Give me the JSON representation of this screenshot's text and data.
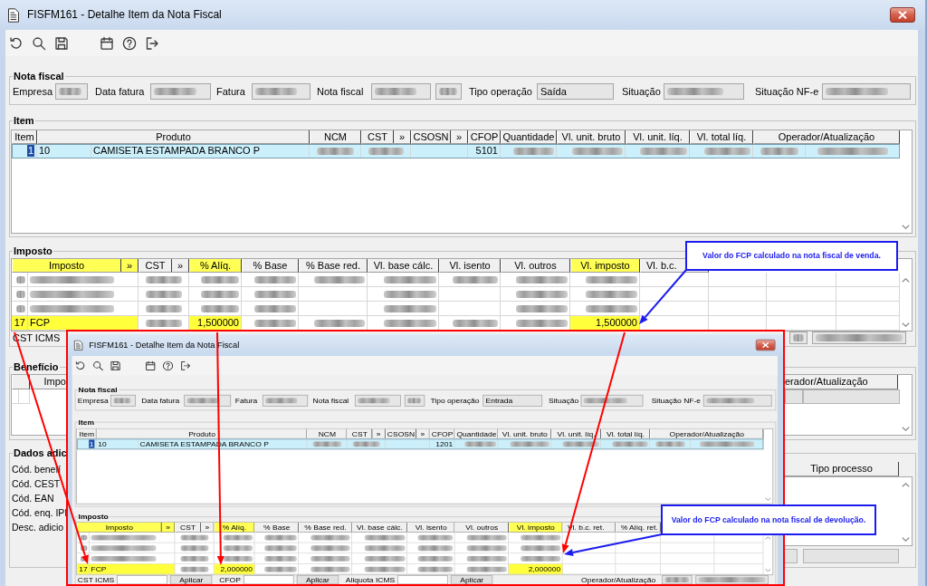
{
  "window": {
    "title": "FISFM161 - Detalhe Item da Nota Fiscal",
    "nota_fiscal": {
      "title": "Nota fiscal",
      "fields": [
        {
          "label": "Empresa",
          "kind": "blurred"
        },
        {
          "label": "Data fatura",
          "kind": "blurred"
        },
        {
          "label": "Fatura",
          "kind": "blurred"
        },
        {
          "label": "Nota fiscal",
          "kind": "blurred"
        },
        {
          "kind": "blurred"
        },
        {
          "label": "Tipo operação",
          "kind": "text",
          "value": "Saída"
        },
        {
          "label": "Situação",
          "kind": "blurred"
        },
        {
          "label": "Situação NF-e",
          "kind": "blurred"
        }
      ]
    },
    "item": {
      "title": "Item",
      "columns": [
        {
          "kind": "header",
          "label": "Item"
        },
        {
          "kind": "joined"
        },
        {
          "kind": "header",
          "label": "Produto"
        },
        {
          "kind": "header",
          "label": "NCM"
        },
        {
          "kind": "header",
          "label": "CST",
          "button": "»"
        },
        {
          "kind": "header",
          "label": "CSOSN",
          "button": "»"
        },
        {
          "kind": "header",
          "label": "CFOP"
        },
        {
          "kind": "header",
          "label": "Quantidade"
        },
        {
          "kind": "header",
          "label": "Vl. unit. bruto"
        },
        {
          "kind": "header",
          "label": "Vl. unit. líq."
        },
        {
          "kind": "header",
          "label": "Vl. total líq."
        },
        {
          "kind": "joined"
        },
        {
          "kind": "header",
          "label": "Operador/Atualização"
        }
      ],
      "rows": [
        {
          "selected": true,
          "cells": [
            {
              "kind": "text",
              "text": "1"
            },
            {
              "kind": "text",
              "text": "10"
            },
            {
              "kind": "text",
              "text": "CAMISETA ESTAMPADA BRANCO P"
            },
            {
              "kind": "blurred"
            },
            {
              "kind": "blurred"
            },
            {
              "kind": "empty"
            },
            {
              "kind": "text",
              "text": "5101"
            },
            {
              "kind": "blurred"
            },
            {
              "kind": "blurred"
            },
            {
              "kind": "blurred"
            },
            {
              "kind": "blurred"
            },
            {
              "kind": "blurred"
            },
            {
              "kind": "blurred"
            }
          ]
        }
      ]
    },
    "imposto": {
      "title": "Imposto",
      "columns": [
        {
          "kind": "joined",
          "highlighted": true
        },
        {
          "kind": "header",
          "label": "Imposto",
          "button": "»",
          "highlighted": true
        },
        {
          "kind": "header",
          "label": "CST",
          "button": "»",
          "highlighted": false
        },
        {
          "kind": "header",
          "label": "% Alíq.",
          "highlighted": true
        },
        {
          "kind": "header",
          "label": "% Base",
          "highlighted": false
        },
        {
          "kind": "header",
          "label": "% Base red.",
          "highlighted": false
        },
        {
          "kind": "header",
          "label": "Vl. base cálc.",
          "highlighted": false
        },
        {
          "kind": "header",
          "label": "Vl. isento",
          "highlighted": false
        },
        {
          "kind": "header",
          "label": "Vl. outros",
          "highlighted": false
        },
        {
          "kind": "header",
          "label": "Vl. imposto",
          "highlighted": true
        },
        {
          "kind": "header",
          "label": "Vl. b.c.",
          "highlighted": false
        }
      ],
      "rows": [
        {
          "highlighted": false,
          "cells": [
            {
              "kind": "blurred"
            },
            {
              "kind": "blurred"
            },
            {
              "kind": "blurred"
            },
            {
              "kind": "blurred"
            },
            {
              "kind": "blurred"
            },
            {
              "kind": "blurred"
            },
            {
              "kind": "blurred"
            },
            {
              "kind": "blurred"
            },
            {
              "kind": "blurred"
            },
            {
              "kind": "blurred"
            }
          ]
        },
        {
          "highlighted": false,
          "cells": [
            {
              "kind": "blurred"
            },
            {
              "kind": "blurred"
            },
            {
              "kind": "blurred"
            },
            {
              "kind": "blurred"
            },
            {
              "kind": "blurred"
            },
            {
              "kind": "empty"
            },
            {
              "kind": "blurred"
            },
            {
              "kind": "empty"
            },
            {
              "kind": "blurred"
            },
            {
              "kind": "blurred"
            }
          ]
        },
        {
          "highlighted": false,
          "cells": [
            {
              "kind": "blurred"
            },
            {
              "kind": "blurred"
            },
            {
              "kind": "blurred"
            },
            {
              "kind": "blurred"
            },
            {
              "kind": "blurred"
            },
            {
              "kind": "empty"
            },
            {
              "kind": "blurred"
            },
            {
              "kind": "empty"
            },
            {
              "kind": "blurred"
            },
            {
              "kind": "blurred"
            }
          ]
        },
        {
          "highlighted": true,
          "cells": [
            {
              "kind": "text",
              "text": "17"
            },
            {
              "kind": "text",
              "text": "FCP"
            },
            {
              "kind": "blurred"
            },
            {
              "kind": "text",
              "text": "1,500000"
            },
            {
              "kind": "blurred"
            },
            {
              "kind": "blurred"
            },
            {
              "kind": "blurred"
            },
            {
              "kind": "blurred"
            },
            {
              "kind": "blurred"
            },
            {
              "kind": "text",
              "text": "1,500000"
            }
          ]
        }
      ],
      "footer": {
        "left": [
          {
            "kind": "label",
            "text": "CST ICMS"
          }
        ],
        "right": [
          {
            "kind": "blurred"
          },
          {
            "kind": "blurred"
          }
        ]
      }
    },
    "beneficio": {
      "title": "Benefício",
      "columns": [
        "Impo",
        "erador/Atualização"
      ]
    },
    "dados_adicionais": {
      "title": "Dados adic",
      "labels": [
        "Cód. benefí",
        "Cód. CEST",
        "Cód. EAN",
        "Cód. enq. IPI",
        "Desc. adicio"
      ],
      "columns": [
        "Tipo processo"
      ]
    }
  },
  "inset": {
    "window": {
      "title": "FISFM161 - Detalhe Item da Nota Fiscal",
      "nota_fiscal": {
        "title": "Nota fiscal",
        "fields": [
          {
            "label": "Empresa",
            "kind": "blurred"
          },
          {
            "label": "Data fatura",
            "kind": "blurred"
          },
          {
            "label": "Fatura",
            "kind": "blurred"
          },
          {
            "label": "Nota fiscal",
            "kind": "blurred"
          },
          {
            "kind": "blurred"
          },
          {
            "label": "Tipo operação",
            "kind": "text",
            "value": "Entrada"
          },
          {
            "label": "Situação",
            "kind": "blurred"
          },
          {
            "label": "Situação NF-e",
            "kind": "blurred"
          }
        ]
      },
      "item": {
        "title": "Item",
        "columns": [
          {
            "kind": "header",
            "label": "Item"
          },
          {
            "kind": "joined"
          },
          {
            "kind": "header",
            "label": "Produto"
          },
          {
            "kind": "header",
            "label": "NCM"
          },
          {
            "kind": "header",
            "label": "CST",
            "button": "»"
          },
          {
            "kind": "header",
            "label": "CSOSN",
            "button": "»"
          },
          {
            "kind": "header",
            "label": "CFOP"
          },
          {
            "kind": "header",
            "label": "Quantidade"
          },
          {
            "kind": "header",
            "label": "Vl. unit. bruto"
          },
          {
            "kind": "header",
            "label": "Vl. unit. líq."
          },
          {
            "kind": "header",
            "label": "Vl. total líq."
          },
          {
            "kind": "joined"
          },
          {
            "kind": "header",
            "label": "Operador/Atualização"
          }
        ],
        "rows": [
          {
            "selected": true,
            "cells": [
              {
                "kind": "text",
                "text": "1"
              },
              {
                "kind": "text",
                "text": "10"
              },
              {
                "kind": "text",
                "text": "CAMISETA ESTAMPADA BRANCO P"
              },
              {
                "kind": "blurred"
              },
              {
                "kind": "blurred"
              },
              {
                "kind": "empty"
              },
              {
                "kind": "text",
                "text": "1201"
              },
              {
                "kind": "blurred"
              },
              {
                "kind": "blurred"
              },
              {
                "kind": "blurred"
              },
              {
                "kind": "blurred"
              },
              {
                "kind": "blurred"
              },
              {
                "kind": "blurred"
              }
            ]
          }
        ]
      },
      "imposto": {
        "title": "Imposto",
        "columns": [
          {
            "kind": "joined",
            "highlighted": true
          },
          {
            "kind": "header",
            "label": "Imposto",
            "button": "»",
            "highlighted": true
          },
          {
            "kind": "header",
            "label": "CST",
            "button": "»",
            "highlighted": false
          },
          {
            "kind": "header",
            "label": "% Alíq.",
            "highlighted": true
          },
          {
            "kind": "header",
            "label": "% Base",
            "highlighted": false
          },
          {
            "kind": "header",
            "label": "% Base red.",
            "highlighted": false
          },
          {
            "kind": "header",
            "label": "Vl. base cálc.",
            "highlighted": false
          },
          {
            "kind": "header",
            "label": "Vl. isento",
            "highlighted": false
          },
          {
            "kind": "header",
            "label": "Vl. outros",
            "highlighted": false
          },
          {
            "kind": "header",
            "label": "Vl. imposto",
            "highlighted": true
          },
          {
            "kind": "header",
            "label": "Vl. b.c. ret.",
            "highlighted": false
          },
          {
            "kind": "header",
            "label": "% Alíq. ret.",
            "highlighted": false
          }
        ],
        "rows": [
          {
            "highlighted": false,
            "cells": [
              {
                "kind": "blurred"
              },
              {
                "kind": "blurred"
              },
              {
                "kind": "blurred"
              },
              {
                "kind": "blurred"
              },
              {
                "kind": "blurred"
              },
              {
                "kind": "blurred"
              },
              {
                "kind": "blurred"
              },
              {
                "kind": "blurred"
              },
              {
                "kind": "blurred"
              },
              {
                "kind": "blurred"
              }
            ]
          },
          {
            "highlighted": false,
            "cells": [
              {
                "kind": "blurred"
              },
              {
                "kind": "blurred"
              },
              {
                "kind": "blurred"
              },
              {
                "kind": "blurred"
              },
              {
                "kind": "blurred"
              },
              {
                "kind": "blurred"
              },
              {
                "kind": "blurred"
              },
              {
                "kind": "blurred"
              },
              {
                "kind": "blurred"
              },
              {
                "kind": "blurred"
              }
            ]
          },
          {
            "highlighted": false,
            "cells": [
              {
                "kind": "blurred"
              },
              {
                "kind": "blurred"
              },
              {
                "kind": "blurred"
              },
              {
                "kind": "blurred"
              },
              {
                "kind": "blurred"
              },
              {
                "kind": "blurred"
              },
              {
                "kind": "blurred"
              },
              {
                "kind": "blurred"
              },
              {
                "kind": "blurred"
              },
              {
                "kind": "blurred"
              }
            ]
          },
          {
            "highlighted": true,
            "cells": [
              {
                "kind": "text",
                "text": "17"
              },
              {
                "kind": "text",
                "text": "FCP"
              },
              {
                "kind": "blurred"
              },
              {
                "kind": "text",
                "text": "2,000000"
              },
              {
                "kind": "blurred"
              },
              {
                "kind": "blurred"
              },
              {
                "kind": "blurred"
              },
              {
                "kind": "blurred"
              },
              {
                "kind": "blurred"
              },
              {
                "kind": "text",
                "text": "2,000000"
              }
            ]
          }
        ],
        "footer": {
          "left": [
            {
              "kind": "label",
              "text": "CST ICMS"
            },
            {
              "kind": "field"
            },
            {
              "kind": "button",
              "text": "Aplicar"
            },
            {
              "kind": "label",
              "text": "CFOP"
            },
            {
              "kind": "field"
            },
            {
              "kind": "button",
              "text": "Aplicar"
            },
            {
              "kind": "label",
              "text": "Aliquota ICMS"
            },
            {
              "kind": "field"
            },
            {
              "kind": "button",
              "text": "Aplicar"
            }
          ],
          "right": [
            {
              "kind": "label",
              "text": "Operador/Atualização"
            },
            {
              "kind": "blurred"
            },
            {
              "kind": "blurred"
            }
          ]
        }
      }
    }
  },
  "callouts": [
    {
      "text": "Valor do FCP calculado na nota fiscal de venda."
    },
    {
      "text": "Valor do FCP calculado na nota fiscal de devolução."
    }
  ]
}
